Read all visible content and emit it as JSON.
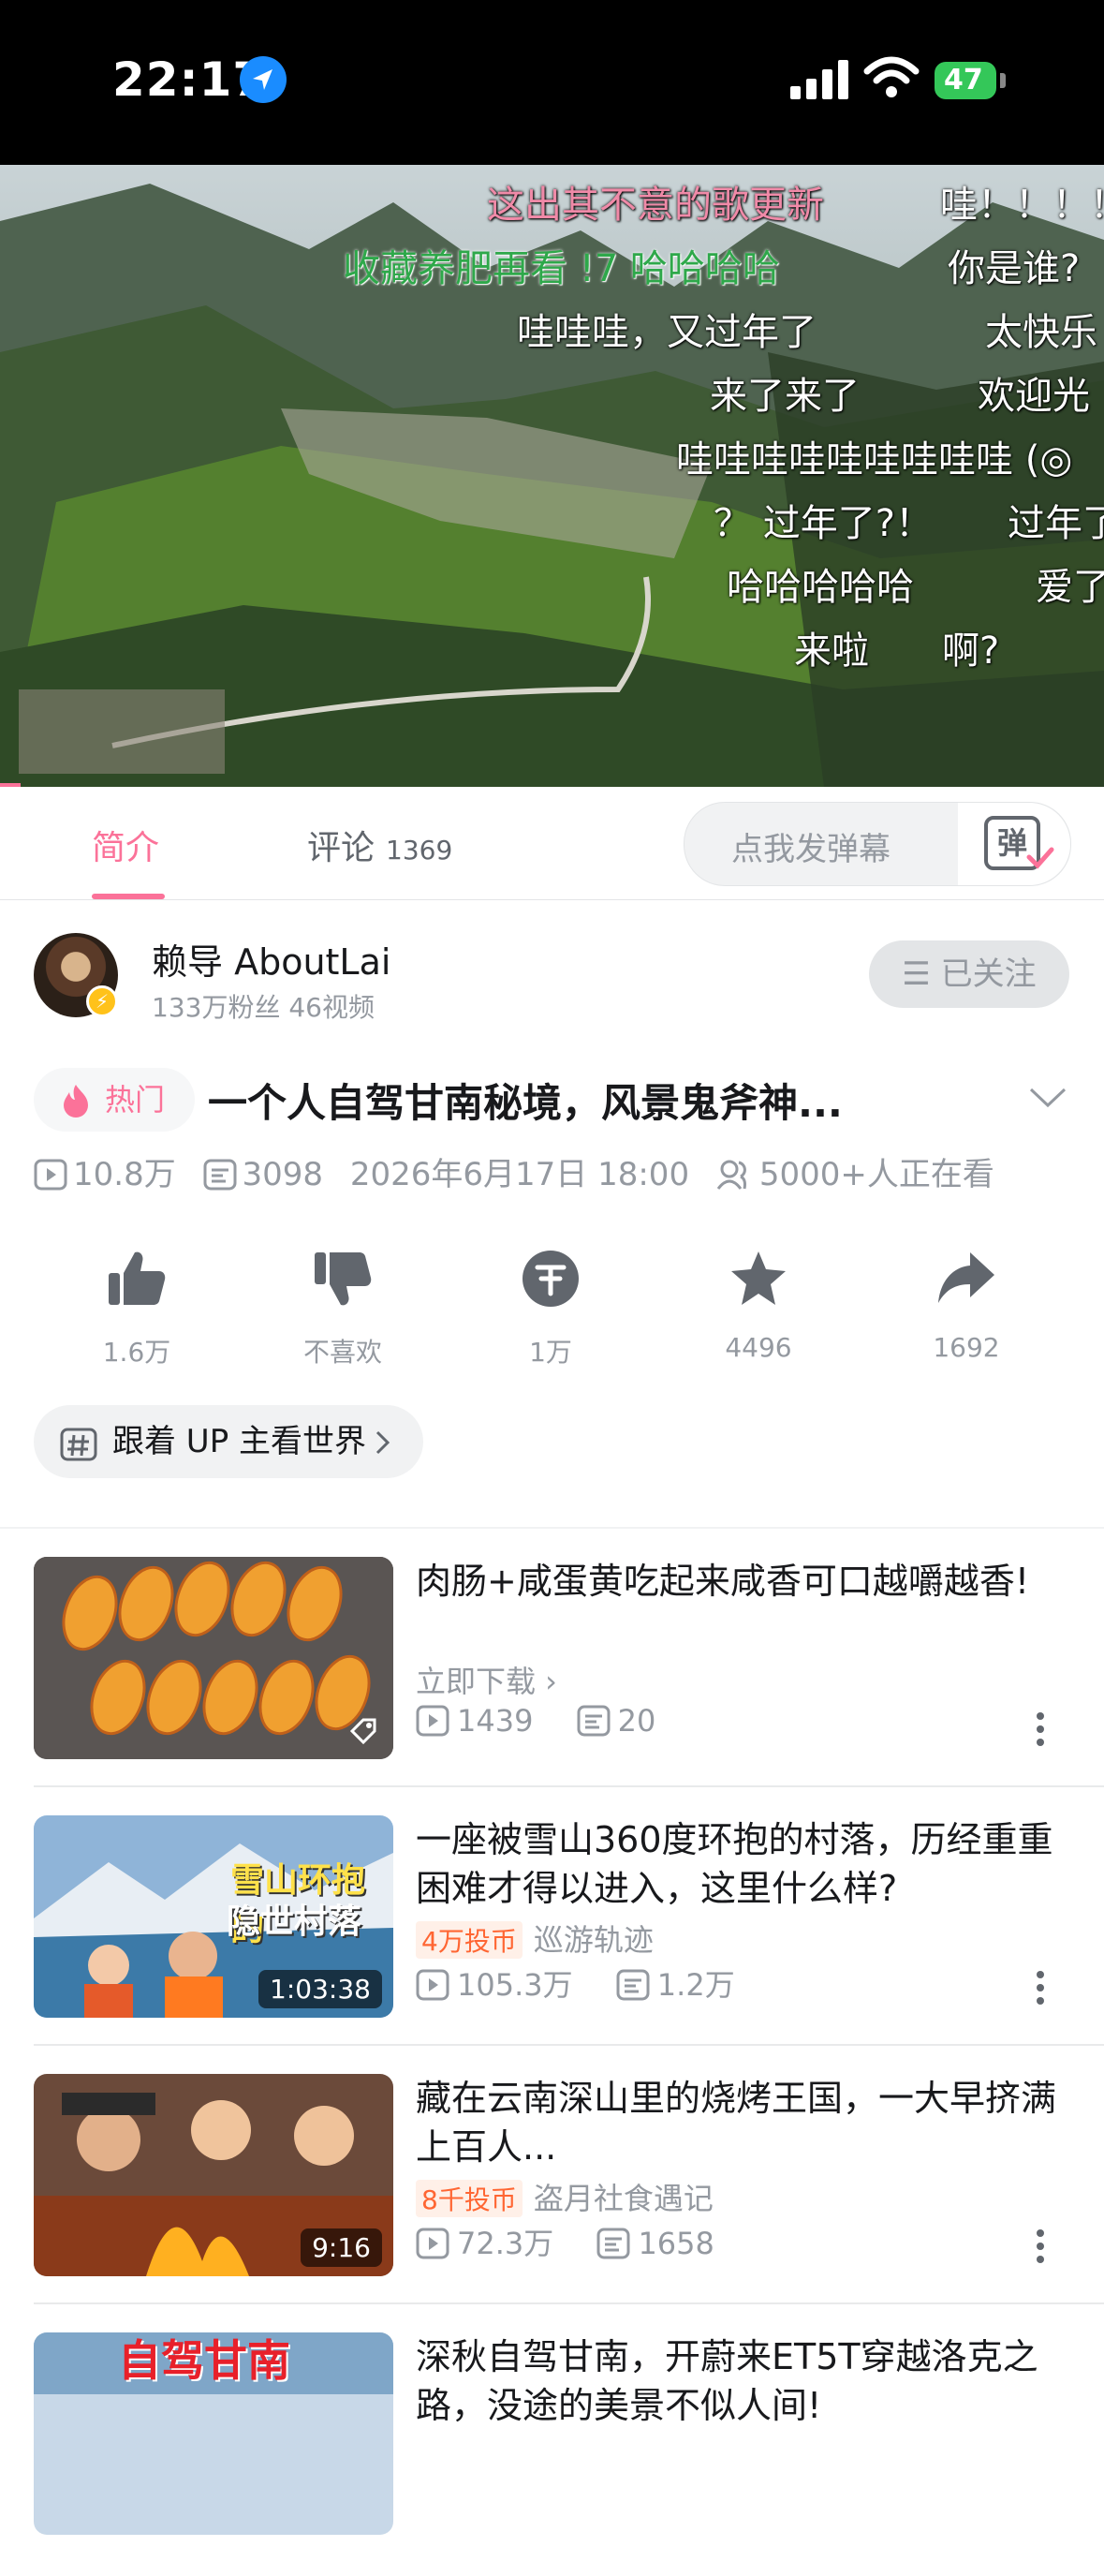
{
  "status_bar": {
    "time": "22:17",
    "battery": "47"
  },
  "video": {
    "danmaku": [
      "这出其不意的歌更新",
      "哇！！！！！",
      "收藏养肥再看 !7 哈哈哈哈",
      "你是谁?",
      "哇哇哇，又过年了",
      "太快乐",
      "来了来了",
      "欢迎光",
      "哇哇哇哇哇哇哇哇哇 (◎",
      "？ 过年了?！",
      "过年了",
      "哈哈哈哈哈",
      "爱了",
      "来啦",
      "啊?"
    ]
  },
  "tabs": {
    "intro": "简介",
    "comments": "评论",
    "comments_count": "1369",
    "danmaku_placeholder": "点我发弹幕",
    "danmaku_button": "弹"
  },
  "uploader": {
    "name": "赖导 AboutLai",
    "stats": "133万粉丝  46视频",
    "follow_label": "☰ 已关注"
  },
  "video_info": {
    "hot_label": "热门",
    "title": "一个人自驾甘南秘境，风景鬼斧神...",
    "views": "10.8万",
    "danmaku_count": "3098",
    "date": "2026年6月17日 18:00",
    "watching": "5000+人正在看"
  },
  "actions": {
    "like": "1.6万",
    "dislike": "不喜欢",
    "coin": "1万",
    "favorite": "4496",
    "share": "1692"
  },
  "topic": {
    "label": "跟着 UP 主看世界"
  },
  "related": [
    {
      "title": "肉肠+咸蛋黄吃起来咸香可口越嚼越香!",
      "sub": "立即下载 ›",
      "coin": "",
      "author": "",
      "views": "1439",
      "danmaku": "20",
      "duration": ""
    },
    {
      "title": "一座被雪山360度环抱的村落，历经重重困难才得以进入，这里什么样?",
      "coin": "4万投币",
      "author": "巡游轨迹",
      "views": "105.3万",
      "danmaku": "1.2万",
      "duration": "1:03:38",
      "thumb_text": [
        "雪山环抱的",
        "隐世村落"
      ]
    },
    {
      "title": "藏在云南深山里的烧烤王国，一大早挤满上百人...",
      "coin": "8千投币",
      "author": "盗月社食遇记",
      "views": "72.3万",
      "danmaku": "1658",
      "duration": "9:16"
    },
    {
      "title": "深秋自驾甘南，开蔚来ET5T穿越洛克之路，没途的美景不似人间!",
      "thumb_text": [
        "自驾甘南"
      ]
    }
  ],
  "colors": {
    "accent": "#fb7299",
    "coin": "#ff6633",
    "muted": "#9499a0"
  }
}
